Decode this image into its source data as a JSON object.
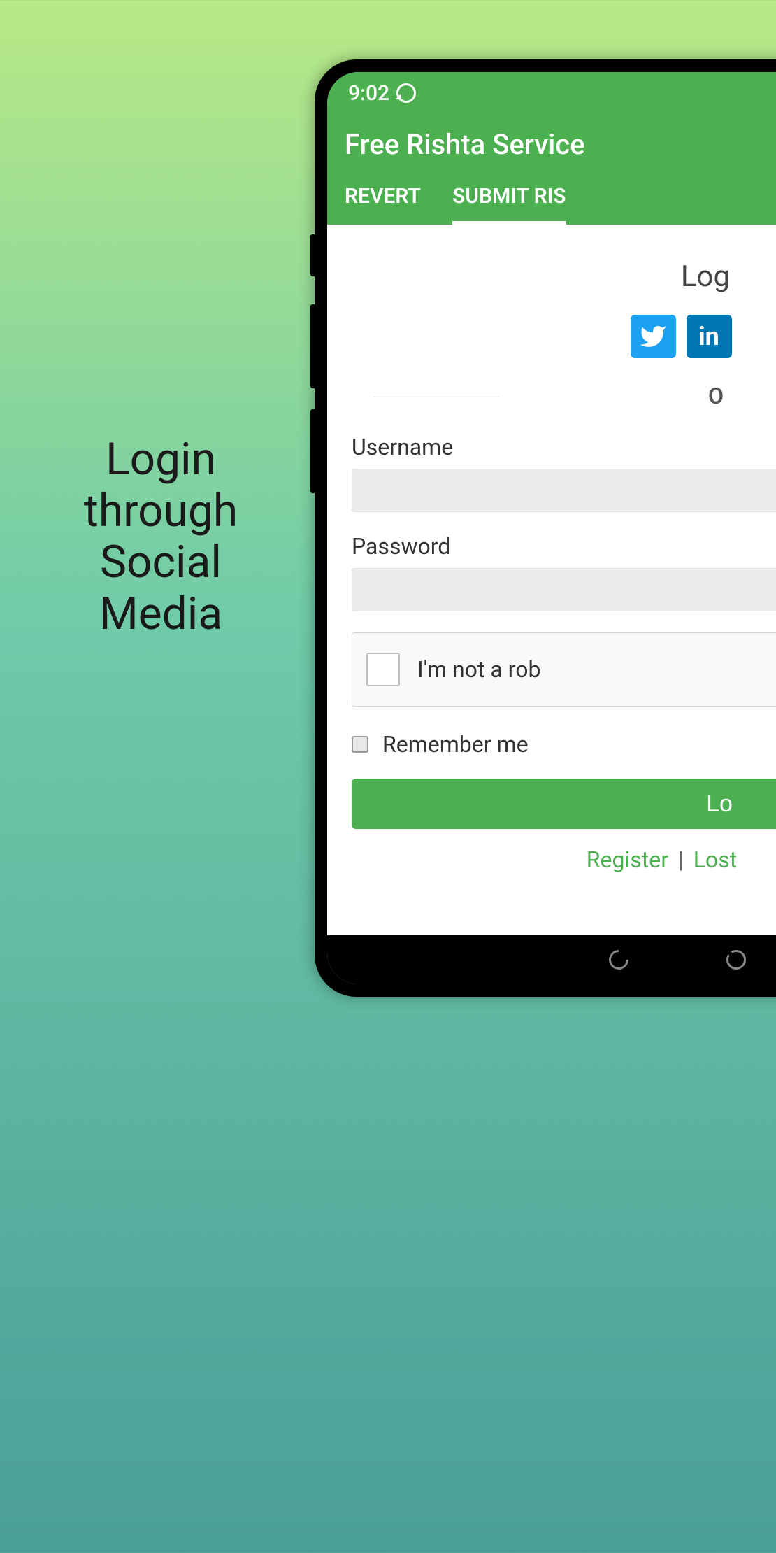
{
  "promo": {
    "text": "Login through Social Media"
  },
  "status_bar": {
    "time": "9:02"
  },
  "header": {
    "title": "Free Rishta Service"
  },
  "tabs": {
    "revert": "REVERT",
    "submit": "SUBMIT RIS"
  },
  "login": {
    "heading": "Log",
    "divider_text": "O",
    "username_label": "Username",
    "username_value": "",
    "password_label": "Password",
    "password_value": "",
    "captcha_label": "I'm not a rob",
    "remember_label": "Remember me",
    "login_button": "Lo",
    "register_link": "Register",
    "separator": "|",
    "lost_link": "Lost"
  }
}
